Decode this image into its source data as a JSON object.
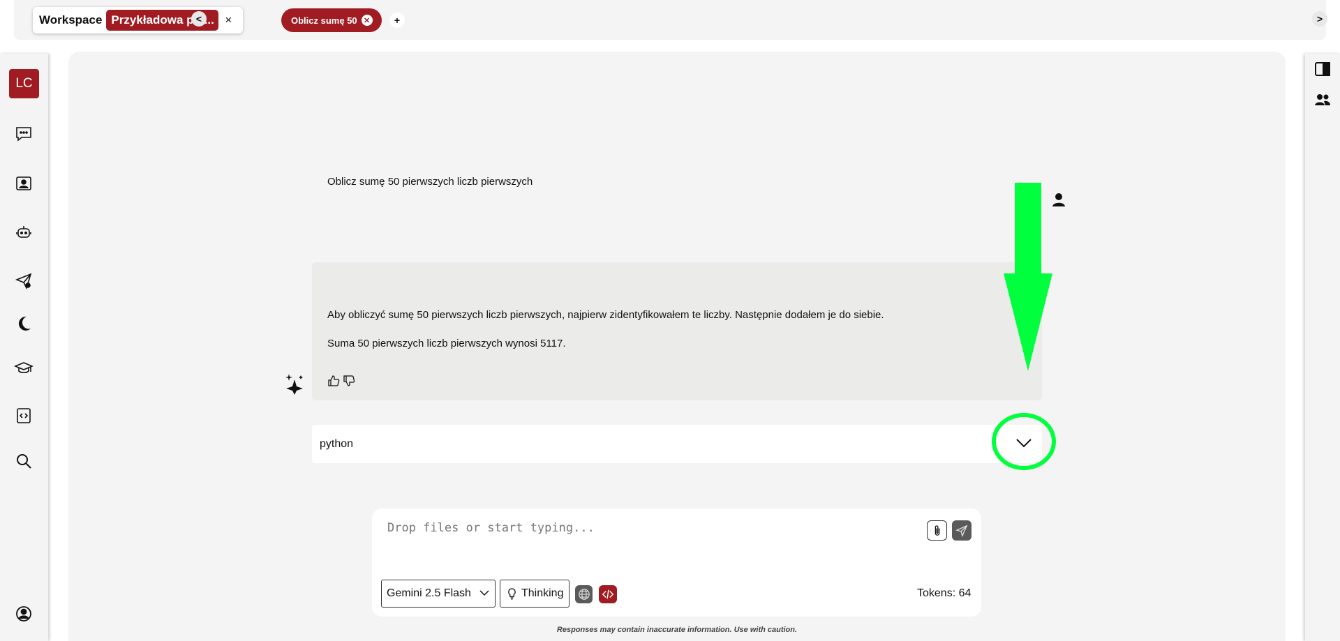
{
  "topbar": {
    "workspace_label": "Workspace",
    "project_name": "Przykładowa prz...",
    "close_glyph": "×",
    "prev_glyph": "<",
    "next_glyph": ">",
    "active_chat_tab": "Oblicz sumę 50",
    "add_tab_glyph": "+"
  },
  "sidebar": {
    "avatar_initials": "LC",
    "items": [
      {
        "name": "chat-icon"
      },
      {
        "name": "contact-card-icon"
      },
      {
        "name": "robot-icon"
      },
      {
        "name": "send-alert-icon"
      },
      {
        "name": "moon-icon"
      },
      {
        "name": "graduation-cap-icon"
      },
      {
        "name": "code-file-icon"
      },
      {
        "name": "search-icon"
      },
      {
        "name": "account-circle-icon"
      }
    ]
  },
  "right_sidebar": {
    "items": [
      {
        "name": "panel-toggle-icon"
      },
      {
        "name": "users-icon"
      }
    ]
  },
  "conversation": {
    "user_message": "Oblicz sumę 50 pierwszych liczb pierwszych",
    "ai_paragraph_1": "Aby obliczyć sumę 50 pierwszych liczb pierwszych, najpierw zidentyfikowałem te liczby. Następnie dodałem je do siebie.",
    "ai_paragraph_2": "Suma 50 pierwszych liczb pierwszych wynosi 5117.",
    "code_block_language": "python"
  },
  "composer": {
    "placeholder": "Drop files or start typing...",
    "model": "Gemini 2.5 Flash",
    "thinking_label": "Thinking",
    "tokens_label": "Tokens: 64"
  },
  "footer": {
    "disclaimer": "Responses may contain inaccurate information. Use with caution."
  },
  "colors": {
    "accent": "#a01c22",
    "annotation": "#00ff3c"
  }
}
